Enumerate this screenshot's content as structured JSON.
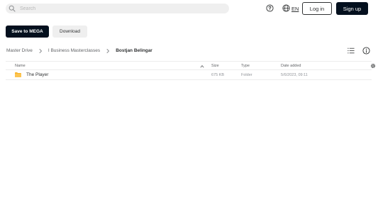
{
  "header": {
    "search_placeholder": "Search",
    "language": "EN",
    "login_label": "Log in",
    "signup_label": "Sign up"
  },
  "actions": {
    "save_label": "Save to MEGA",
    "download_label": "Download"
  },
  "breadcrumb": {
    "items": [
      "Master Drive",
      "I Business Masterclasses",
      "Bostjan Belingar"
    ]
  },
  "table": {
    "columns": [
      "Name",
      "Size",
      "Type",
      "Date added"
    ],
    "rows": [
      {
        "name": "The Player",
        "size": "675 KB",
        "type": "Folder",
        "date": "5/6/2023, 09:11"
      }
    ]
  },
  "colors": {
    "primary_dark": "#04101e",
    "folder": "#f9b42c",
    "surface": "#efefef"
  },
  "icons": [
    "search-icon",
    "help-icon",
    "globe-icon",
    "chevron-right-icon",
    "list-view-icon",
    "info-icon",
    "sort-up-icon",
    "column-settings-icon",
    "folder-icon"
  ]
}
